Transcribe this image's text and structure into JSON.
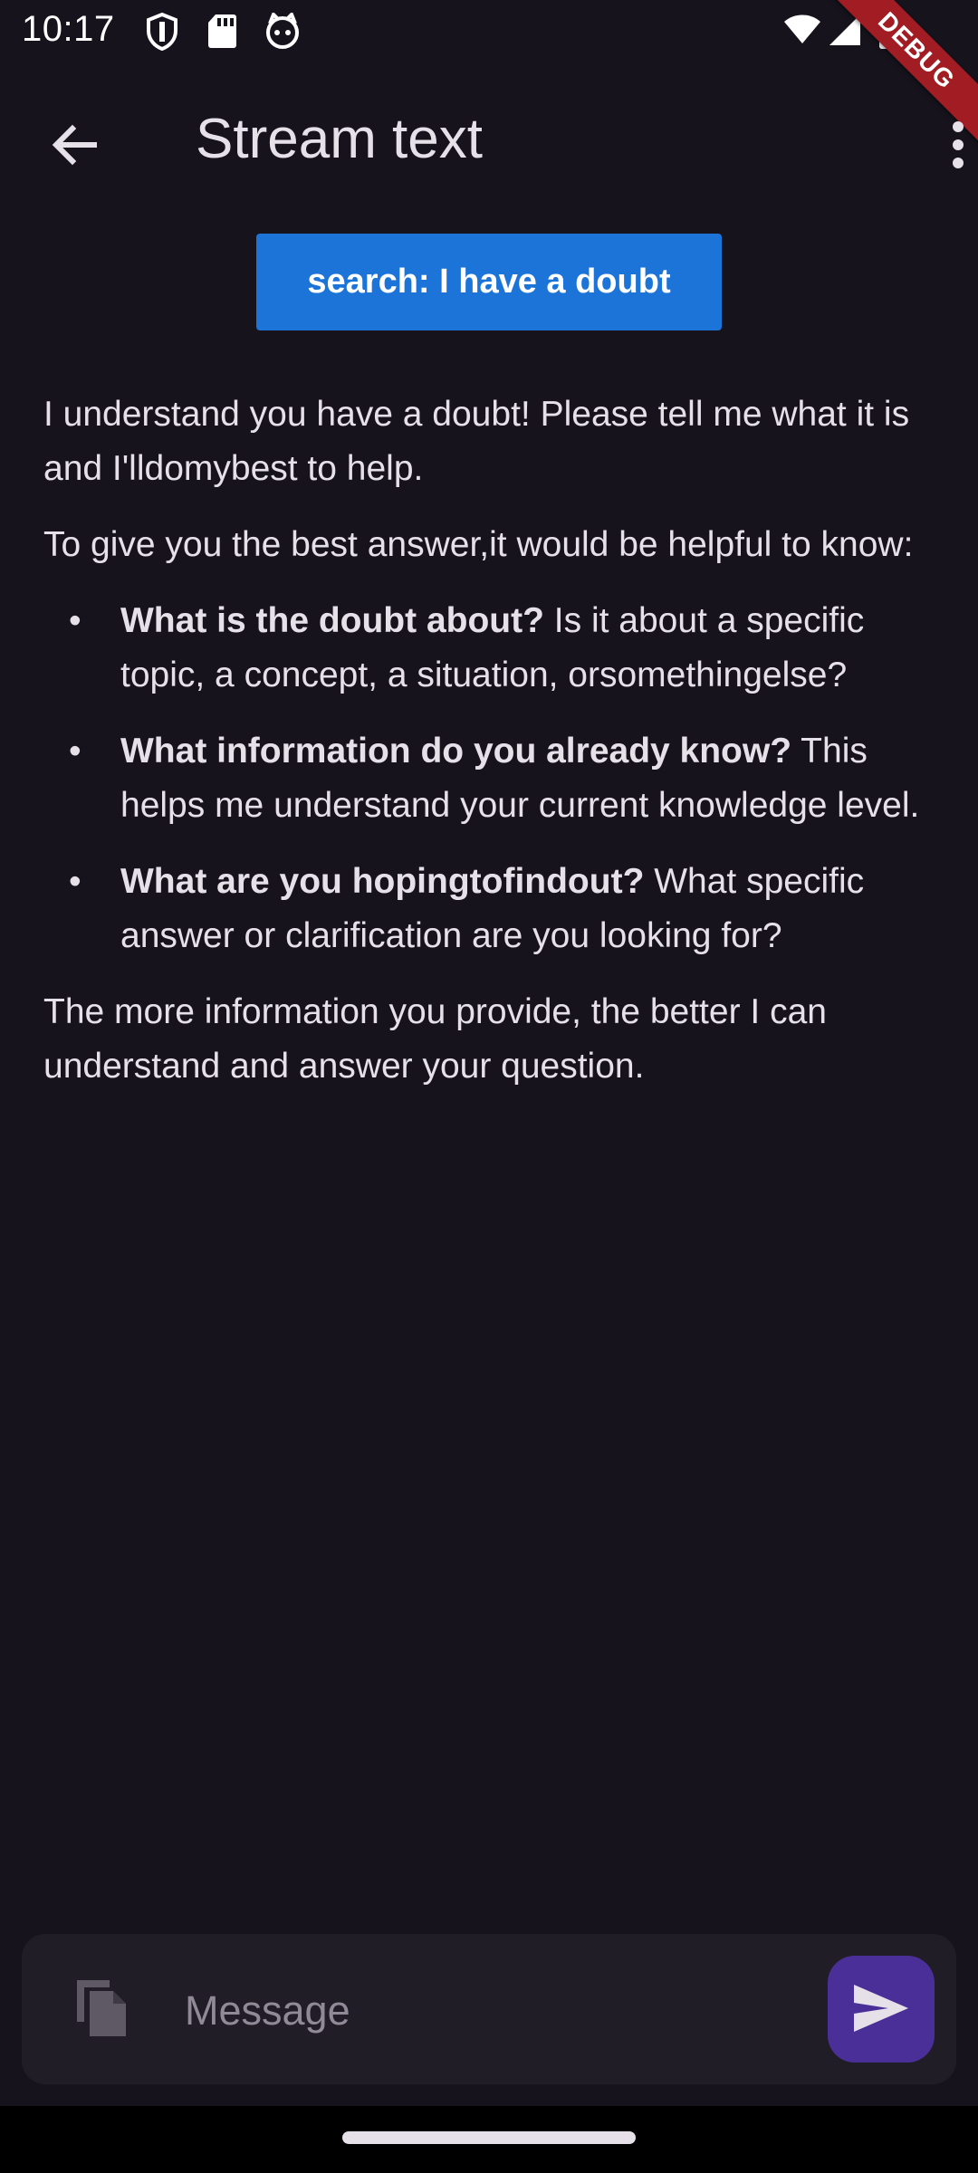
{
  "status_bar": {
    "time": "10:17",
    "left_icons": [
      "shield-icon",
      "sd-card-icon",
      "cat-icon"
    ],
    "right_icons": [
      "wifi-icon",
      "signal-icon",
      "battery-icon"
    ]
  },
  "debug_banner": {
    "label": "DEBUG"
  },
  "app_bar": {
    "title": "Stream text",
    "back_icon": "arrow-back-icon",
    "more_icon": "more-vert-icon"
  },
  "search_button": {
    "label": "search: I have a doubt"
  },
  "response": {
    "intro": "I understand you have a doubt!  Please tell me what it is and I'lldomybest to help.",
    "lead": "To give you the best answer,it would be helpful to know:",
    "bullets": [
      {
        "bold": "What is the doubt about?",
        "text": "  Is it about a specific topic, a concept, a situation, orsomethingelse?"
      },
      {
        "bold": "What information do you already know?",
        "text": "  This helps me understand your current knowledge level."
      },
      {
        "bold": "What are you hopingtofindout?",
        "text": "  What specific answer or clarification are you looking for?"
      }
    ],
    "bullet_char": "•",
    "closing": "The more information you provide, the better I can understand and answer your question."
  },
  "message_bar": {
    "placeholder": "Message",
    "value": "",
    "attach_icon": "file-copy-icon",
    "send_icon": "send-icon"
  },
  "colors": {
    "background": "#16131c",
    "accent_button": "#1c74d8",
    "send_button": "#4b2f98",
    "debug_banner": "#a11c23"
  }
}
